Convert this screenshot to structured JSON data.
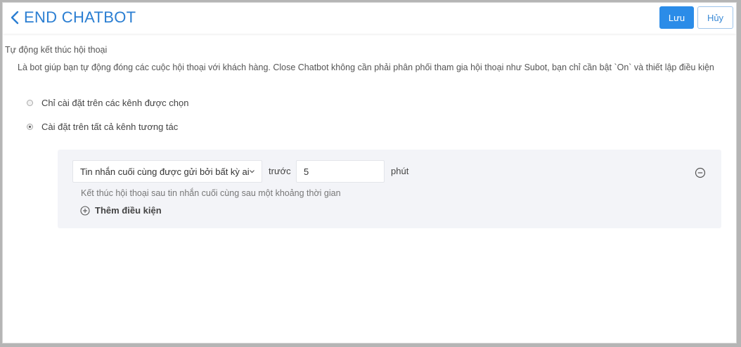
{
  "header": {
    "title": "END CHATBOT",
    "save_label": "Lưu",
    "cancel_label": "Hủy"
  },
  "section": {
    "title": "Tự động kết thúc hội thoại",
    "description": "Là bot giúp bạn tự động đóng các cuộc hội thoại với khách hàng. Close Chatbot không cần phải phân phối tham gia hội thoại như Subot, bạn chỉ cần bật `On` và thiết lập điều kiện"
  },
  "scope_options": [
    {
      "label": "Chỉ cài đặt trên các kênh được chọn",
      "selected": false
    },
    {
      "label": "Cài đặt trên tất cả kênh tương tác",
      "selected": true
    }
  ],
  "condition": {
    "trigger_select": "Tin nhắn cuối cùng được gửi bởi bất kỳ ai",
    "before_label": "trước",
    "minutes_value": "5",
    "unit_label": "phút",
    "hint": "Kết thúc hội thoại sau tin nhắn cuối cùng sau một khoảng thời gian",
    "add_label": "Thêm điều kiện"
  },
  "colors": {
    "accent": "#2b8ce8",
    "title": "#2a7ed2",
    "panel_bg": "#f3f4f8"
  }
}
